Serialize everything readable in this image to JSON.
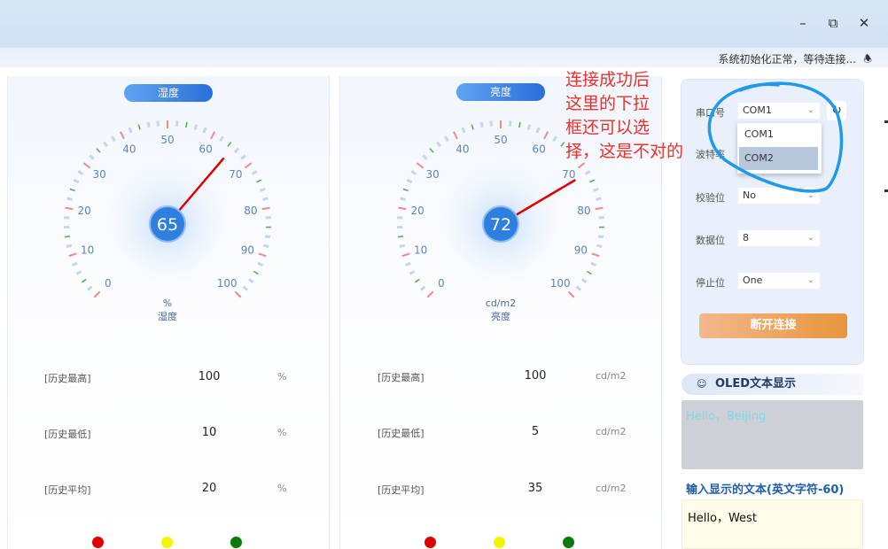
{
  "window": {
    "minimize_icon": "minimize-icon",
    "restore_icon": "restore-icon",
    "close_icon": "close-icon"
  },
  "status": {
    "text": "系统初始化正常，等待连接...",
    "icon": "bell-icon"
  },
  "humidity": {
    "pill": "湿度",
    "value": "65",
    "value_num": 65,
    "unit": "%",
    "name": "湿度",
    "ticks": [
      "0",
      "10",
      "20",
      "30",
      "40",
      "50",
      "60",
      "70",
      "80",
      "90",
      "100"
    ],
    "stats": [
      {
        "label": "[历史最高]",
        "value": "100",
        "unit": "%"
      },
      {
        "label": "[历史最低]",
        "value": "10",
        "unit": "%"
      },
      {
        "label": "[历史平均]",
        "value": "20",
        "unit": "%"
      }
    ]
  },
  "brightness": {
    "pill": "亮度",
    "value": "72",
    "value_num": 72,
    "unit": "cd/m2",
    "name": "亮度",
    "ticks": [
      "0",
      "10",
      "20",
      "30",
      "40",
      "50",
      "60",
      "70",
      "80",
      "90",
      "100"
    ],
    "stats": [
      {
        "label": "[历史最高]",
        "value": "100",
        "unit": "cd/m2"
      },
      {
        "label": "[历史最低]",
        "value": "5",
        "unit": "cd/m2"
      },
      {
        "label": "[历史平均]",
        "value": "35",
        "unit": "cd/m2"
      }
    ]
  },
  "indicators": [
    "#e00000",
    "#f5f500",
    "#0a7a0a"
  ],
  "serial": {
    "port_label": "串口号",
    "port_value": "COM1",
    "baud_label": "波特率",
    "parity_label": "校验位",
    "parity_value": "No",
    "databits_label": "数据位",
    "databits_value": "8",
    "stopbits_label": "停止位",
    "stopbits_value": "One",
    "refresh_icon": "refresh-icon",
    "dropdown_options": [
      "COM1",
      "COM2"
    ],
    "disconnect_label": "断开连接"
  },
  "oled": {
    "header": "OLED文本显示",
    "icon": "display-icon",
    "screen_text": "Hello，Beijing",
    "input_title": "输入显示的文本(英文字符-60)",
    "input_value": "Hello，West"
  },
  "annotation": {
    "lines": [
      "连接成功后",
      "这里的下拉",
      "框还可以选",
      "择，这是不对的"
    ],
    "color": "#e8322c"
  },
  "colors": {
    "accent": "#2f7fe0",
    "needle": "#e00000",
    "button": "#e8953d"
  }
}
